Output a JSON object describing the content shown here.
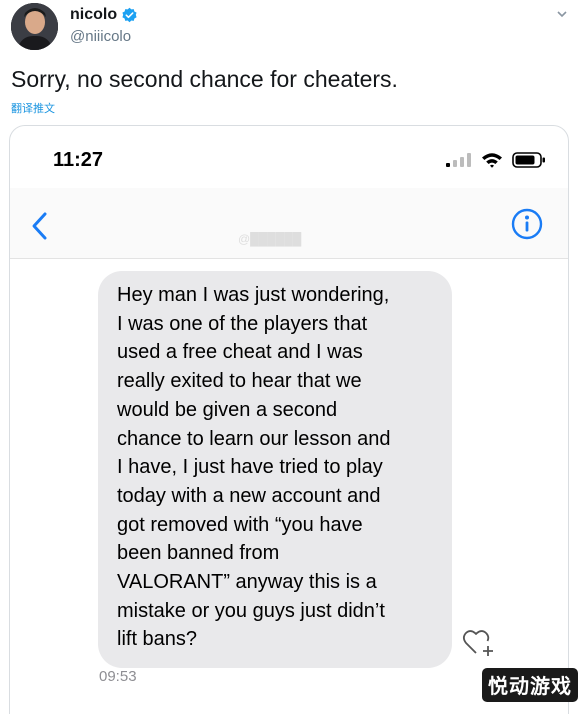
{
  "tweet": {
    "author": {
      "name": "nicolo",
      "handle": "@niiicolo"
    },
    "text": "Sorry, no second chance for cheaters.",
    "translate_label": "翻译推文"
  },
  "screenshot": {
    "status_bar": {
      "time": "11:27",
      "icons": [
        "signal-icon",
        "wifi-icon",
        "battery-icon"
      ]
    },
    "nav": {
      "back_icon": "chevron-left-icon",
      "info_icon": "info-icon"
    },
    "message": {
      "lines": [
        "Hey man I was just wondering,",
        "I was one of the players that",
        "used a free cheat and I was",
        "really exited to hear that we",
        "would be given a second",
        "chance to learn our lesson and",
        "I have, I just have tried to play",
        "today with a new account and",
        "got removed with “you have",
        "been banned from",
        "VALORANT” anyway this is a",
        "mistake or you guys just didn’t",
        "lift bans?"
      ],
      "time": "09:53"
    }
  },
  "watermark": "悦动游戏",
  "colors": {
    "ios_blue": "#1a7cf5",
    "twitter_blue": "#1da1f2",
    "bubble_gray": "#e9e9eb",
    "handle_gray": "#657786"
  }
}
